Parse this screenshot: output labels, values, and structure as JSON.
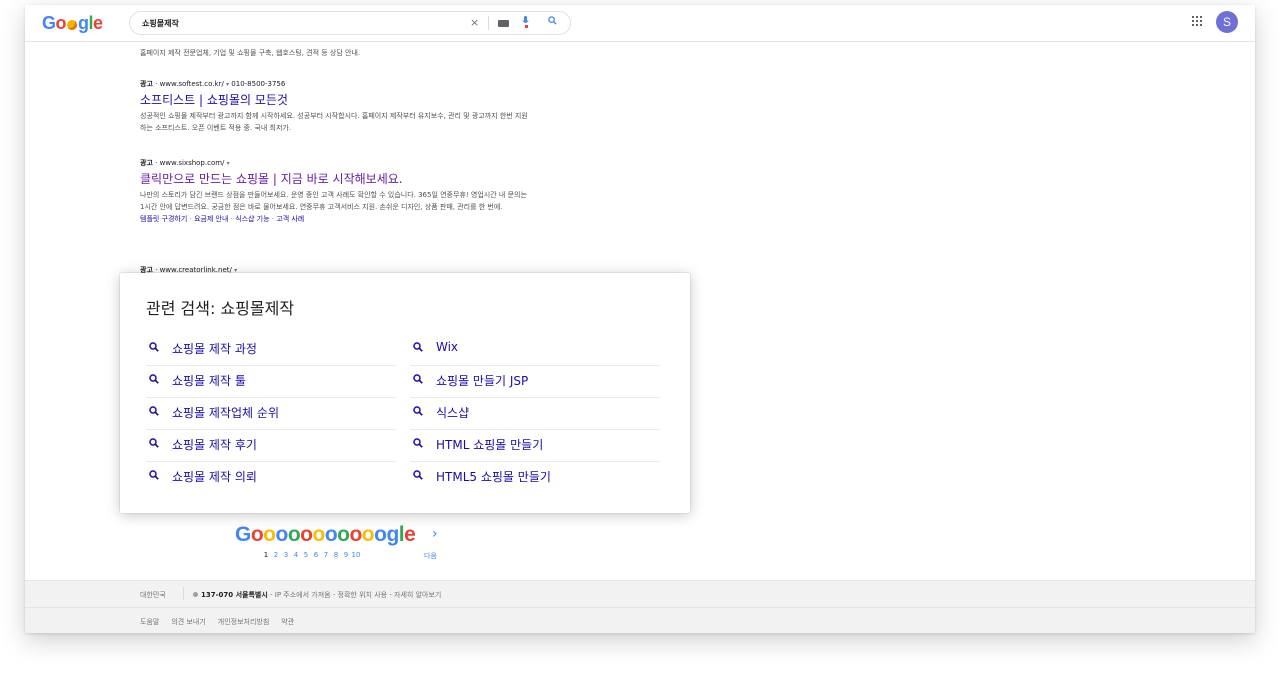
{
  "header": {
    "logo": {
      "G": "G",
      "o1": "o",
      "g": "g",
      "l": "l",
      "e": "e"
    },
    "search_value": "쇼핑몰제작",
    "clear_label": "×",
    "avatar_letter": "S"
  },
  "results": {
    "top_snippet": "홈페이지 제작 전문업체, 기업 및 쇼핑몰 구축, 웹호스팅, 견적 등 상담 안내.",
    "ads": [
      {
        "label": "광고",
        "url": "www.softest.co.kr/",
        "phone": "010-8500-3756",
        "title": "소프티스트 | 쇼핑몰의 모든것",
        "desc": "성공적인 쇼핑몰 제작부터 광고까지 함께 시작하세요. 성공부터 시작합시다. 홈페이지 제작부터 유지보수, 관리 및 광고까지 한번 지원하는 소프티스트. 오픈 이벤트 적용 중. 국내 최저가."
      },
      {
        "label": "광고",
        "url": "www.sixshop.com/",
        "title": "클릭만으로 만드는 쇼핑몰 | 지금 바로 시작해보세요.",
        "desc": "나만의 스토리가 담긴 브랜드 상점을 만들어보세요. 운영 중인 고객 사례도 확인할 수 있습니다. 365일 연중무휴! 영업시간 내 문의는 1시간 안에 답변드려요. 궁금한 점은 바로 물어보세요. 연중무휴 고객서비스 지원. 손쉬운 디자인, 상품 판매, 관리를 한 번에.",
        "links": [
          "템플릿 구경하기",
          "요금제 안내",
          "식스샵 기능",
          "고객 사례"
        ]
      },
      {
        "label": "광고",
        "url": "www.creatorlink.net/"
      }
    ]
  },
  "related": {
    "heading": "관련 검색: 쇼핑몰제작",
    "left": [
      "쇼핑몰 제작 과정",
      "쇼핑몰 제작 툴",
      "쇼핑몰 제작업체 순위",
      "쇼핑몰 제작 후기",
      "쇼핑몰 제작 의뢰"
    ],
    "right": [
      "Wix",
      "쇼핑몰 만들기 JSP",
      "식스샵",
      "HTML 쇼핑몰 만들기",
      "HTML5 쇼핑몰 만들기"
    ]
  },
  "pager": {
    "pages": [
      "1",
      "2",
      "3",
      "4",
      "5",
      "6",
      "7",
      "8",
      "9",
      "10"
    ],
    "next_label": "다음",
    "next_arrow": "›"
  },
  "footer": {
    "country": "대한민국",
    "location_bold": "137-070 서울특별시",
    "location_rest": " - IP 주소에서 가져옴 - 정확한 위치 사용 - 자세히 알아보기",
    "links": [
      "도움말",
      "의견 보내기",
      "개인정보처리방침",
      "약관"
    ]
  },
  "colors": {
    "link": "#1a0dab",
    "visited": "#681da8",
    "google_blue": "#4285f4",
    "google_red": "#ea4335",
    "google_yellow": "#fbbc05",
    "google_green": "#34a853",
    "avatar": "#6f6fd8"
  }
}
